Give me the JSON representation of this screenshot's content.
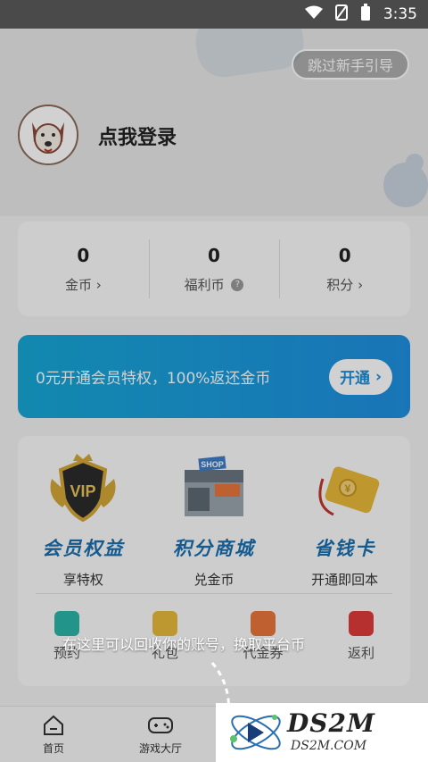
{
  "status_bar": {
    "time": "3:35",
    "icons": [
      "wifi-icon",
      "no-sim-icon",
      "battery-icon"
    ]
  },
  "skip_guide_label": "跳过新手引导",
  "user": {
    "login_label": "点我登录"
  },
  "stats": [
    {
      "value": "0",
      "label": "金币",
      "suffix": "chevron-right-icon"
    },
    {
      "value": "0",
      "label": "福利币",
      "suffix": "help-icon"
    },
    {
      "value": "0",
      "label": "积分",
      "suffix": "chevron-right-icon"
    }
  ],
  "vip_banner": {
    "text": "0元开通会员特权，100%返还金币",
    "button_label": "开通"
  },
  "features": [
    {
      "title": "会员权益",
      "subtitle": "享特权",
      "icon": "vip-shield-icon"
    },
    {
      "title": "积分商城",
      "subtitle": "兑金币",
      "icon": "shop-icon"
    },
    {
      "title": "省钱卡",
      "subtitle": "开通即回本",
      "icon": "money-card-icon"
    }
  ],
  "quick_links": [
    {
      "label": "预约",
      "icon": "alarm-clock-icon",
      "color": "#2bb5a8"
    },
    {
      "label": "礼包",
      "icon": "gift-icon",
      "color": "#e7b93a"
    },
    {
      "label": "代金券",
      "icon": "coupon-icon",
      "color": "#e8763a"
    },
    {
      "label": "返利",
      "icon": "red-envelope-icon",
      "color": "#e03b3b"
    }
  ],
  "guide_tip": "在这里可以回收你的账号，换取平台币",
  "bottom_tabs": [
    {
      "label": "首页",
      "icon": "home-icon"
    },
    {
      "label": "游戏大厅",
      "icon": "gamepad-icon"
    }
  ],
  "watermark": {
    "title": "DS2M",
    "subtitle": "DS2M.COM"
  },
  "colors": {
    "accent": "#1a8fdc",
    "banner_start": "#17a7d6",
    "banner_end": "#1f8fe0",
    "feature_title": "#1a6fb0"
  }
}
